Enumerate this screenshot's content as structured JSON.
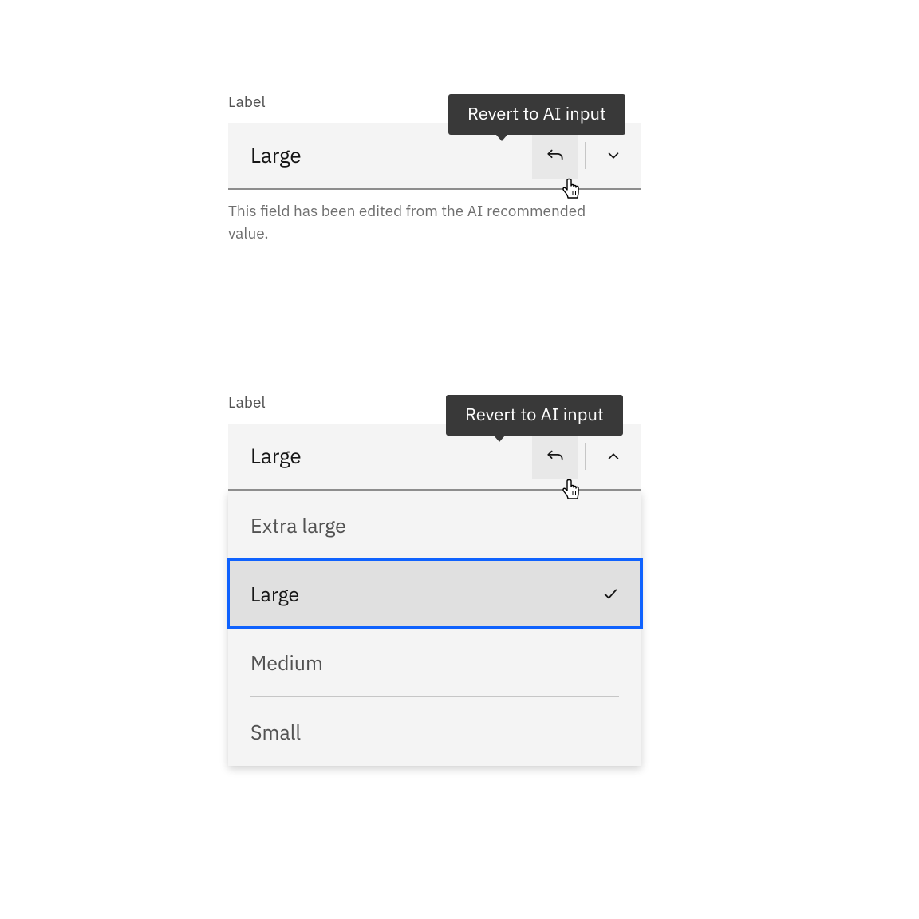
{
  "dropdown1": {
    "label": "Label",
    "value": "Large",
    "tooltip": "Revert to AI input",
    "helper": "This field has been edited from the AI recommended value."
  },
  "dropdown2": {
    "label": "Label",
    "value": "Large",
    "tooltip": "Revert to AI input",
    "options": [
      "Extra large",
      "Large",
      "Medium",
      "Small"
    ],
    "selected": "Large"
  },
  "colors": {
    "tooltip_bg": "#393939",
    "focus_border": "#0f62fe",
    "field_bg": "#f4f4f4"
  }
}
